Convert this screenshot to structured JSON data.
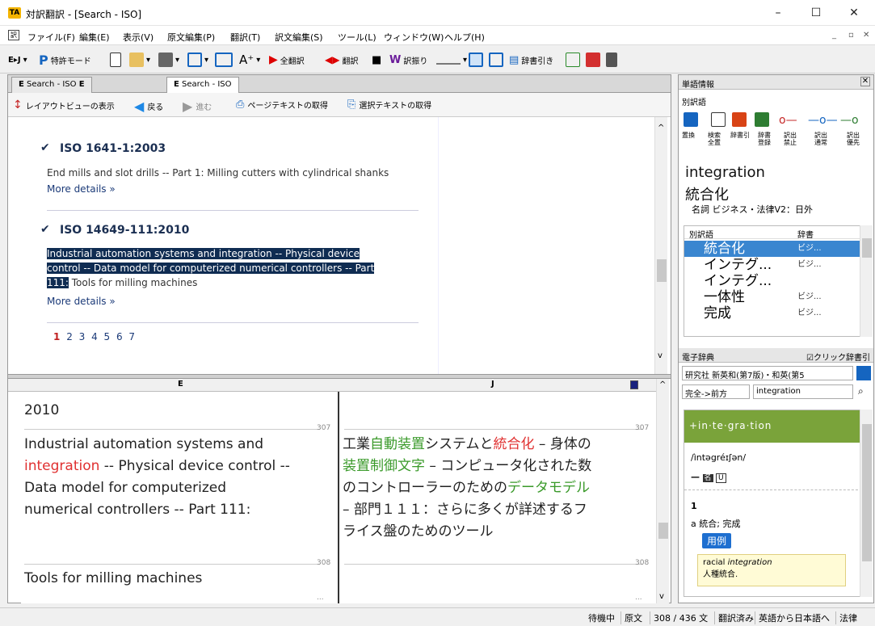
{
  "window": {
    "title": "対訳翻訳 - [Search - ISO]",
    "app_icon": "TA",
    "min": "–",
    "max": "☐",
    "close": "✕"
  },
  "menu": {
    "items": [
      "ファイル(F)",
      "編集(E)",
      "表示(V)",
      "原文編集(P)",
      "翻訳(T)",
      "訳文編集(S)",
      "ツール(L)",
      "ウィンドウ(W)",
      "ヘルプ(H)"
    ],
    "icon": "訳",
    "mdi": [
      "_",
      "▫",
      "✕"
    ]
  },
  "toolbar": {
    "bj": "E▸J",
    "patent": "特許モード",
    "translate_all": "全翻訳",
    "translate": "翻訳",
    "wordbreak": "訳振り",
    "dict_lookup": "辞書引き"
  },
  "tabs": [
    {
      "label": "Search - ISO",
      "lang": "E"
    },
    {
      "label": "Search - ISO",
      "lang": "E"
    }
  ],
  "nav": {
    "layout": "レイアウトビューの表示",
    "back": "戻る",
    "forward": "進む",
    "get_page": "ページテキストの取得",
    "get_sel": "選択テキストの取得"
  },
  "web": {
    "results": [
      {
        "id": "ISO 1641-1:2003",
        "desc": "End mills and slot drills -- Part 1: Milling cutters with cylindrical shanks",
        "more": "More details »"
      },
      {
        "id": "ISO 14649-111:2010",
        "desc_hl_1": "Industrial automation systems and integration -- Physical device",
        "desc_hl_2": "control -- Data model for computerized numerical controllers -- Part",
        "desc_hl_3": "111:",
        "desc_rest": " Tools for milling machines",
        "more": "More details »"
      }
    ],
    "pager_current": "1",
    "pager_rest": "2 3 4 5 6 7"
  },
  "pair": {
    "head_e": "E",
    "head_j": "J",
    "seg0_e": "2010",
    "seg1_no": "307",
    "seg1_e_a": "Industrial automation systems and",
    "seg1_e_b": "integration",
    "seg1_e_c": " -- Physical device control --",
    "seg1_e_d": "Data model for computerized",
    "seg1_e_e": "numerical controllers -- Part 111:",
    "seg1_j_a": "工業",
    "seg1_j_b": "自動装置",
    "seg1_j_c": "システムと",
    "seg1_j_d": "統合化",
    "seg1_j_e": " – 身体の",
    "seg1_j_f": "装置制御文字",
    "seg1_j_g": " – コンピュータ化された数",
    "seg1_j_h": "のコントローラーのための",
    "seg1_j_i": "データモデル",
    "seg1_j_j": "– 部門１１１：さらに多くが詳述するフ",
    "seg1_j_k": "ライス盤のためのツール",
    "seg2_no": "308",
    "seg2_e": "Tools for milling machines",
    "trail": "..."
  },
  "wordinfo": {
    "header": "単語情報",
    "subheader": "別訳語",
    "tools": [
      "置換",
      "検索\n全置",
      "辞書引",
      "辞書\n登録",
      "訳出\n禁止",
      "訳出\n通常",
      "訳出\n優先"
    ],
    "word": "integration",
    "translation": "統合化",
    "pos": "名詞 ビジネス・法律V2：日外",
    "col_alt": "別訳語",
    "col_dict": "辞書",
    "alts": [
      {
        "w": "統合化",
        "d": "ビジ..."
      },
      {
        "w": "インテグ...",
        "d": "ビジ..."
      },
      {
        "w": "インテグ...",
        "d": ""
      },
      {
        "w": "一体性",
        "d": "ビジ..."
      },
      {
        "w": "完成",
        "d": "ビジ..."
      }
    ]
  },
  "edict": {
    "header": "電子辞典",
    "click_dict": "☑クリック辞書引",
    "dict_name": "研究社 新英和(第7版)・和英(第5",
    "mode": "完全->前方",
    "query": "integration",
    "headword": "+in·te·gra·tion",
    "pron": "/ìntəgréɪʃən/",
    "pos_mark": "—",
    "pos_label": "名",
    "u": "U",
    "sense_no": "1",
    "sense": "a 統合; 完成",
    "example_label": "用例",
    "ex_en_a": "racial ",
    "ex_en_b": "integration",
    "ex_ja": "人種統合."
  },
  "status": [
    "待機中",
    "原文",
    "308 / 436 文",
    "翻訳済み",
    "英語から日本語へ",
    "法律"
  ]
}
